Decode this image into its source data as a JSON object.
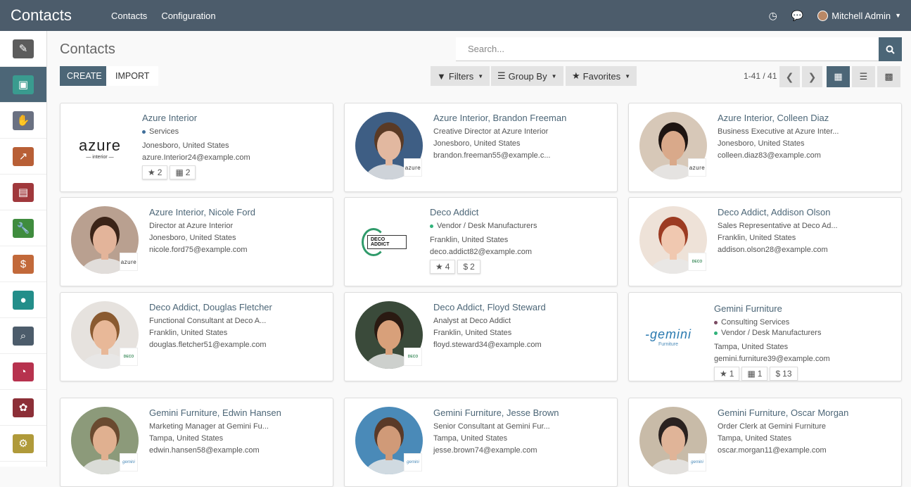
{
  "app": {
    "brand": "Contacts"
  },
  "topnav": [
    "Contacts",
    "Configuration"
  ],
  "user": {
    "name": "Mitchell Admin"
  },
  "sidebar": [
    {
      "icon": "notes-icon",
      "color": "#5c5c5c"
    },
    {
      "icon": "contacts-icon",
      "color": "#4c6677",
      "active": true
    },
    {
      "icon": "handshake-icon",
      "color": "#6a7182"
    },
    {
      "icon": "chart-icon",
      "color": "#b85f36"
    },
    {
      "icon": "box-icon",
      "color": "#a0383c"
    },
    {
      "icon": "wrench-icon",
      "color": "#3f8c3e"
    },
    {
      "icon": "invoice-icon",
      "color": "#c2693a"
    },
    {
      "icon": "team-icon",
      "color": "#238e8a"
    },
    {
      "icon": "search-doc-icon",
      "color": "#4c5c6b"
    },
    {
      "icon": "dashboard-icon",
      "color": "#b7324e"
    },
    {
      "icon": "apps-icon",
      "color": "#8c2f37"
    },
    {
      "icon": "settings-icon",
      "color": "#b09a3a"
    }
  ],
  "control": {
    "title": "Contacts",
    "search_placeholder": "Search...",
    "create": "CREATE",
    "import": "IMPORT",
    "filters": "Filters",
    "group_by": "Group By",
    "favorites": "Favorites",
    "pager": "1-41 / 41"
  },
  "cards": [
    {
      "name": "Azure Interior",
      "kind": "logo",
      "logo": "azure",
      "tags": [
        {
          "label": "Services",
          "color": "#3f6e9a"
        }
      ],
      "lines": [
        "Jonesboro, United States",
        "azure.Interior24@example.com"
      ],
      "chips": [
        {
          "icon": "★",
          "val": "2"
        },
        {
          "icon": "▦",
          "val": "2"
        }
      ]
    },
    {
      "name": "Azure Interior, Brandon Freeman",
      "kind": "person",
      "badge": "azure",
      "skin": "#e2b8a0",
      "hair": "#5a3a25",
      "bg": "#3e5e84",
      "lines": [
        "Creative Director at Azure Interior",
        "Jonesboro, United States",
        "brandon.freeman55@example.c..."
      ],
      "chips": []
    },
    {
      "name": "Azure Interior, Colleen Diaz",
      "kind": "person",
      "badge": "azure",
      "skin": "#d9a98a",
      "hair": "#1e1512",
      "bg": "#d7c8b8",
      "lines": [
        "Business Executive at Azure Inter...",
        "Jonesboro, United States",
        "colleen.diaz83@example.com"
      ],
      "chips": []
    },
    {
      "name": "Azure Interior, Nicole Ford",
      "kind": "person",
      "badge": "azure",
      "skin": "#e3b49a",
      "hair": "#3b2418",
      "bg": "#b9a090",
      "lines": [
        "Director at Azure Interior",
        "Jonesboro, United States",
        "nicole.ford75@example.com"
      ],
      "chips": []
    },
    {
      "name": "Deco Addict",
      "kind": "logo",
      "logo": "deco",
      "tags": [
        {
          "label": "Vendor / Desk Manufacturers",
          "color": "#30b27a"
        }
      ],
      "lines": [
        "Franklin, United States",
        "deco.addict82@example.com"
      ],
      "chips": [
        {
          "icon": "★",
          "val": "4"
        },
        {
          "icon": "$",
          "val": "2"
        }
      ]
    },
    {
      "name": "Deco Addict, Addison Olson",
      "kind": "person",
      "badge": "deco",
      "skin": "#f0c8b0",
      "hair": "#9c3b22",
      "bg": "#eee2d8",
      "lines": [
        "Sales Representative at Deco Ad...",
        "Franklin, United States",
        "addison.olson28@example.com"
      ],
      "chips": []
    },
    {
      "name": "Deco Addict, Douglas Fletcher",
      "kind": "person",
      "badge": "deco",
      "skin": "#e8b898",
      "hair": "#8a5a30",
      "bg": "#e6e2de",
      "lines": [
        "Functional Consultant at Deco A...",
        "Franklin, United States",
        "douglas.fletcher51@example.com"
      ],
      "chips": []
    },
    {
      "name": "Deco Addict, Floyd Steward",
      "kind": "person",
      "badge": "deco",
      "skin": "#d8a07a",
      "hair": "#2a1a12",
      "bg": "#3a4a3a",
      "lines": [
        "Analyst at Deco Addict",
        "Franklin, United States",
        "floyd.steward34@example.com"
      ],
      "chips": []
    },
    {
      "name": "Gemini Furniture",
      "kind": "logo",
      "logo": "gemini",
      "tags": [
        {
          "label": "Consulting Services",
          "color": "#7a4a62"
        },
        {
          "label": "Vendor / Desk Manufacturers",
          "color": "#30b27a"
        }
      ],
      "lines": [
        "Tampa, United States",
        "gemini.furniture39@example.com"
      ],
      "chips": [
        {
          "icon": "★",
          "val": "1"
        },
        {
          "icon": "▦",
          "val": "1"
        },
        {
          "icon": "$",
          "val": "13"
        }
      ]
    },
    {
      "name": "Gemini Furniture, Edwin Hansen",
      "kind": "person",
      "badge": "gemini",
      "skin": "#e0b090",
      "hair": "#6a4a30",
      "bg": "#8c9a7a",
      "lines": [
        "Marketing Manager at Gemini Fu...",
        "Tampa, United States",
        "edwin.hansen58@example.com"
      ],
      "chips": []
    },
    {
      "name": "Gemini Furniture, Jesse Brown",
      "kind": "person",
      "badge": "gemini",
      "skin": "#d09a78",
      "hair": "#5a3a28",
      "bg": "#4a8ab8",
      "lines": [
        "Senior Consultant at Gemini Fur...",
        "Tampa, United States",
        "jesse.brown74@example.com"
      ],
      "chips": []
    },
    {
      "name": "Gemini Furniture, Oscar Morgan",
      "kind": "person",
      "badge": "gemini",
      "skin": "#e0b498",
      "hair": "#2a2220",
      "bg": "#c8bba8",
      "lines": [
        "Order Clerk at Gemini Furniture",
        "Tampa, United States",
        "oscar.morgan11@example.com"
      ],
      "chips": []
    }
  ]
}
